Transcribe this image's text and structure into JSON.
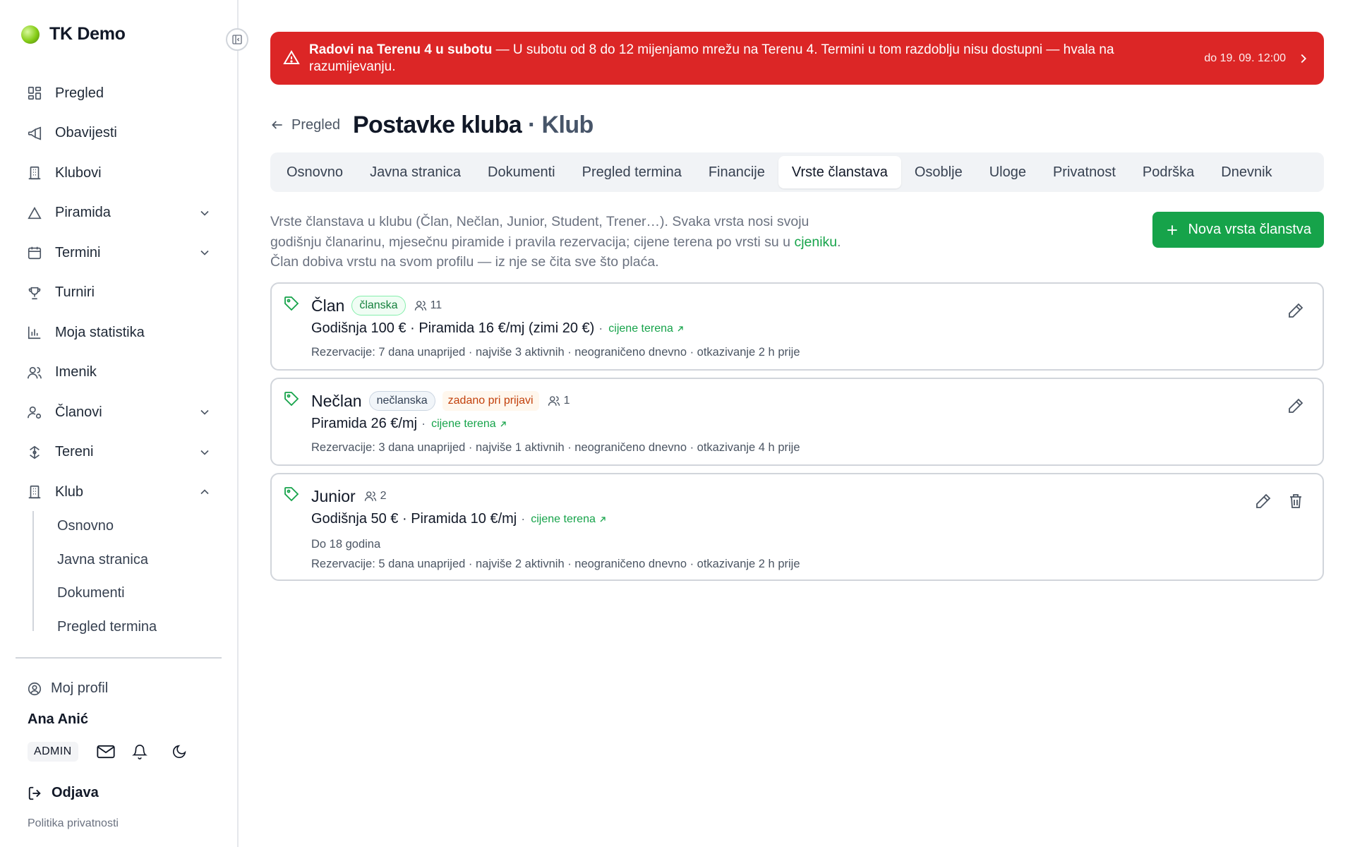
{
  "sidebar": {
    "brand": "TK Demo",
    "nav": [
      {
        "label": "Pregled",
        "icon": "dashboard-icon"
      },
      {
        "label": "Obavijesti",
        "icon": "megaphone-icon"
      },
      {
        "label": "Klubovi",
        "icon": "building-icon"
      },
      {
        "label": "Piramida",
        "icon": "triangle-icon",
        "expandable": true
      },
      {
        "label": "Termini",
        "icon": "calendar-icon",
        "expandable": true
      },
      {
        "label": "Turniri",
        "icon": "trophy-icon"
      },
      {
        "label": "Moja statistika",
        "icon": "bar-chart-icon"
      },
      {
        "label": "Imenik",
        "icon": "users-icon"
      },
      {
        "label": "Članovi",
        "icon": "user-gear-icon",
        "expandable": true
      },
      {
        "label": "Tereni",
        "icon": "court-icon",
        "expandable": true
      },
      {
        "label": "Klub",
        "icon": "building-icon",
        "expandable": true,
        "expanded": true
      }
    ],
    "klub_sub": [
      "Osnovno",
      "Javna stranica",
      "Dokumenti",
      "Pregled termina"
    ],
    "profile_link": "Moj profil",
    "user_name": "Ana Anić",
    "role": "ADMIN",
    "logout": "Odjava",
    "privacy": "Politika privatnosti"
  },
  "banner": {
    "title": "Radovi na Terenu 4 u subotu",
    "message": " — U subotu od 8 do 12 mijenjamo mrežu na Terenu 4. Termini u tom razdoblju nisu dostupni — hvala na razumijevanju.",
    "until": "do 19. 09. 12:00",
    "color": "#dc2626"
  },
  "header": {
    "back": "Pregled",
    "title": "Postavke kluba",
    "dot": " · ",
    "section": "Klub"
  },
  "tabs": [
    "Osnovno",
    "Javna stranica",
    "Dokumenti",
    "Pregled termina",
    "Financije",
    "Vrste članstava",
    "Osoblje",
    "Uloge",
    "Privatnost",
    "Podrška",
    "Dnevnik"
  ],
  "active_tab": "Vrste članstava",
  "intro": {
    "text1": "Vrste članstava u klubu (Član, Nečlan, Junior, Student, Trener…). Svaka vrsta nosi svoju godišnju članarinu, mjesečnu piramide i pravila rezervacija; cijene terena po vrsti su u ",
    "link": "cjeniku",
    "text2": ". Član dobiva vrstu na svom profilu — iz nje se čita sve što plaća."
  },
  "new_button": "Nova vrsta članstva",
  "accent_color": "#16a34a",
  "memberships": [
    {
      "name": "Član",
      "badge": "članska",
      "count": "11",
      "prices": "Godišnja 100 € · Piramida 16 €/mj (zimi 20 €)",
      "price_link": "cijene terena",
      "note": "",
      "rules": "Rezervacije: 7 dana unaprijed · najviše 3 aktivnih · neograničeno dnevno · otkazivanje 2 h prije"
    },
    {
      "name": "Nečlan",
      "badge": "nečlanska",
      "default_badge": "zadano pri prijavi",
      "count": "1",
      "prices": "Piramida 26 €/mj",
      "price_link": "cijene terena",
      "note": "",
      "rules": "Rezervacije: 3 dana unaprijed · najviše 1 aktivnih · neograničeno dnevno · otkazivanje 4 h prije"
    },
    {
      "name": "Junior",
      "count": "2",
      "prices": "Godišnja 50 € · Piramida 10 €/mj",
      "price_link": "cijene terena",
      "note": "Do 18 godina",
      "rules": "Rezervacije: 5 dana unaprijed · najviše 2 aktivnih · neograničeno dnevno · otkazivanje 2 h prije"
    }
  ]
}
